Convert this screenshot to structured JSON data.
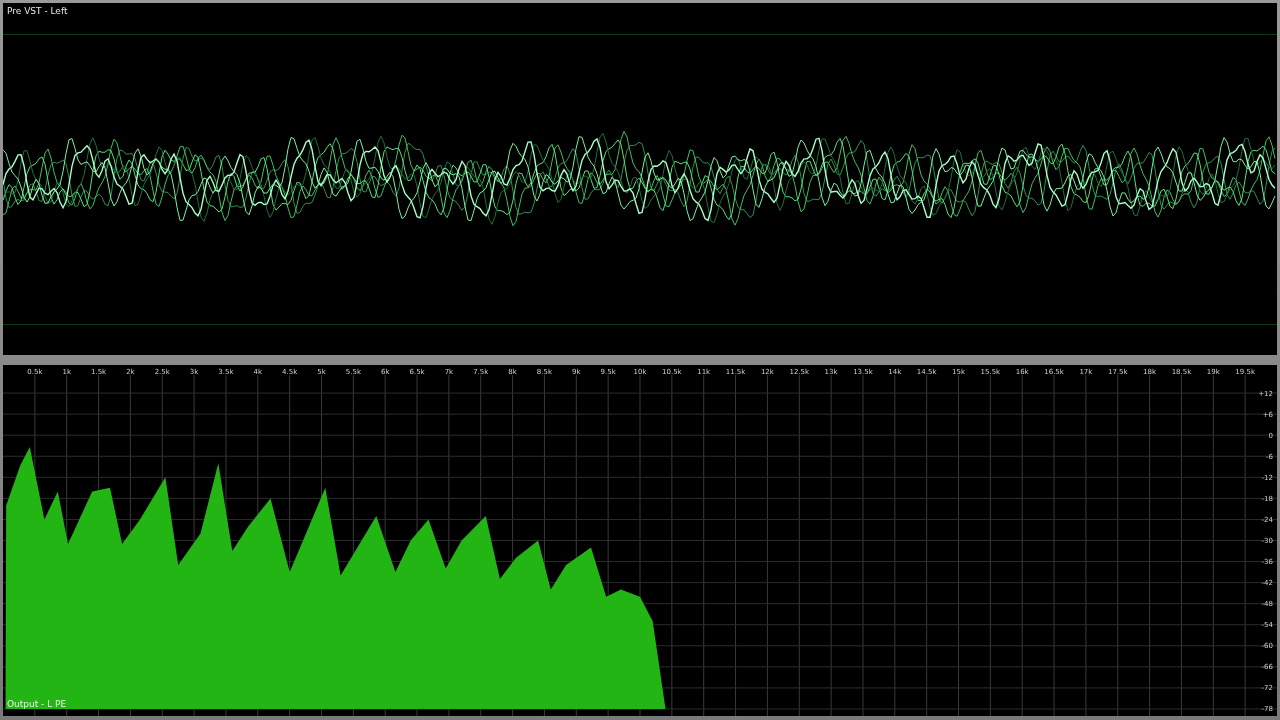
{
  "top_panel": {
    "title": "Pre VST - Left",
    "kind": "picture"
  },
  "spectrum": {
    "label": "Output - L PE",
    "chart_data": {
      "type": "area",
      "x": [
        0.04,
        0.05,
        0.27,
        0.42,
        0.65,
        0.86,
        1.02,
        1.4,
        1.68,
        1.87,
        2.15,
        2.55,
        2.75,
        3.1,
        3.38,
        3.6,
        3.85,
        4.2,
        4.5,
        5.06,
        5.3,
        5.86,
        6.16,
        6.4,
        6.68,
        6.95,
        7.2,
        7.58,
        7.8,
        8.05,
        8.4,
        8.6,
        8.84,
        9.23,
        9.47,
        9.7,
        10.0,
        10.2,
        10.4
      ],
      "series": [
        {
          "color": "#22b514",
          "values": [
            -78,
            -20,
            -8.6,
            -3.4,
            -24,
            -16,
            -31,
            -16,
            -15,
            -31,
            -24,
            -12,
            -37,
            -28,
            -8,
            -33,
            -26,
            -18,
            -39,
            -15,
            -40,
            -23,
            -39,
            -30,
            -24,
            -38,
            -30,
            -23,
            -41,
            -35,
            -30,
            -44,
            -37,
            -32,
            -46,
            -44,
            -46,
            -53,
            -78
          ]
        }
      ],
      "xlim": [
        0,
        20
      ],
      "ylim": [
        -80,
        20
      ],
      "grid": true,
      "xticks": [
        {
          "value": 0.5,
          "label": "0.5k"
        },
        {
          "value": 1,
          "label": "1k"
        },
        {
          "value": 1.5,
          "label": "1.5k"
        },
        {
          "value": 2,
          "label": "2k"
        },
        {
          "value": 2.5,
          "label": "2.5k"
        },
        {
          "value": 3,
          "label": "3k"
        },
        {
          "value": 3.5,
          "label": "3.5k"
        },
        {
          "value": 4,
          "label": "4k"
        },
        {
          "value": 4.5,
          "label": "4.5k"
        },
        {
          "value": 5,
          "label": "5k"
        },
        {
          "value": 5.5,
          "label": "5.5k"
        },
        {
          "value": 6,
          "label": "6k"
        },
        {
          "value": 6.5,
          "label": "6.5k"
        },
        {
          "value": 7,
          "label": "7k"
        },
        {
          "value": 7.5,
          "label": "7.5k"
        },
        {
          "value": 8,
          "label": "8k"
        },
        {
          "value": 8.5,
          "label": "8.5k"
        },
        {
          "value": 9,
          "label": "9k"
        },
        {
          "value": 9.5,
          "label": "9.5k"
        },
        {
          "value": 10,
          "label": "10k"
        },
        {
          "value": 10.5,
          "label": "10.5k"
        },
        {
          "value": 11,
          "label": "11k"
        },
        {
          "value": 11.5,
          "label": "11.5k"
        },
        {
          "value": 12,
          "label": "12k"
        },
        {
          "value": 12.5,
          "label": "12.5k"
        },
        {
          "value": 13,
          "label": "13k"
        },
        {
          "value": 13.5,
          "label": "13.5k"
        },
        {
          "value": 14,
          "label": "14k"
        },
        {
          "value": 14.5,
          "label": "14.5k"
        },
        {
          "value": 15,
          "label": "15k"
        },
        {
          "value": 15.5,
          "label": "15.5k"
        },
        {
          "value": 16,
          "label": "16k"
        },
        {
          "value": 16.5,
          "label": "16.5k"
        },
        {
          "value": 17,
          "label": "17k"
        },
        {
          "value": 17.5,
          "label": "17.5k"
        },
        {
          "value": 18,
          "label": "18k"
        },
        {
          "value": 18.5,
          "label": "18.5k"
        },
        {
          "value": 19,
          "label": "19k"
        },
        {
          "value": 19.5,
          "label": "19.5k"
        }
      ],
      "yticks": [
        {
          "value": 12,
          "label": "+12"
        },
        {
          "value": 6,
          "label": "+6"
        },
        {
          "value": 0,
          "label": "0"
        },
        {
          "value": -6,
          "label": "-6"
        },
        {
          "value": -12,
          "label": "-12"
        },
        {
          "value": -18,
          "label": "-18"
        },
        {
          "value": -24,
          "label": "-24"
        },
        {
          "value": -30,
          "label": "-30"
        },
        {
          "value": -36,
          "label": "-36"
        },
        {
          "value": -42,
          "label": "-42"
        },
        {
          "value": -48,
          "label": "-48"
        },
        {
          "value": -54,
          "label": "-54"
        },
        {
          "value": -60,
          "label": "-60"
        },
        {
          "value": -66,
          "label": "-66"
        },
        {
          "value": -72,
          "label": "-72"
        },
        {
          "value": -78,
          "label": "-78"
        }
      ]
    }
  }
}
